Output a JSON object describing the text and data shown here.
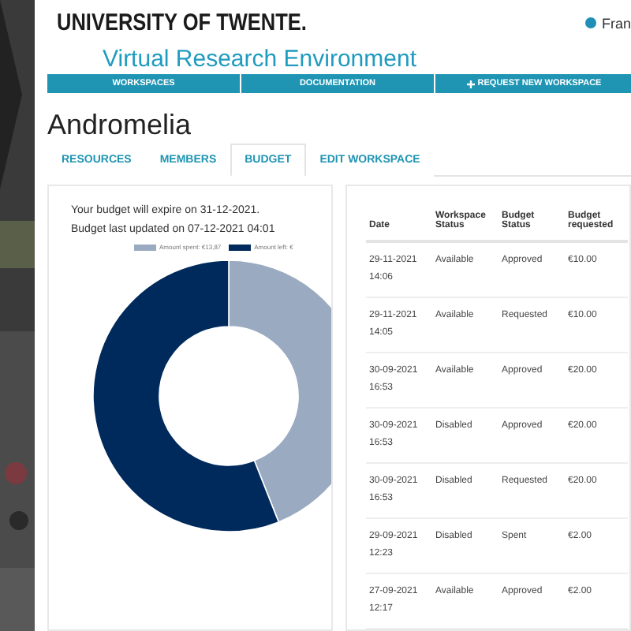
{
  "header": {
    "logo": "UNIVERSITY OF TWENTE.",
    "user": "Fran",
    "title": "Virtual Research Environment"
  },
  "nav": [
    {
      "label": "WORKSPACES",
      "kind": "link"
    },
    {
      "label": "DOCUMENTATION",
      "kind": "link"
    },
    {
      "label": "REQUEST NEW WORKSPACE",
      "kind": "add"
    }
  ],
  "workspace": "Andromelia",
  "tabs": [
    {
      "label": "RESOURCES",
      "selected": false
    },
    {
      "label": "MEMBERS",
      "selected": false
    },
    {
      "label": "BUDGET",
      "selected": true
    },
    {
      "label": "EDIT WORKSPACE",
      "selected": false
    }
  ],
  "budget": {
    "expire": "Your budget will expire on 31-12-2021.",
    "updated": "Budget last updated on 07-12-2021 04:01",
    "legend": [
      {
        "label": "Amount spent: €13,87",
        "color": "#9aabc1"
      },
      {
        "label": "Amount left: €",
        "color": "#002a5c"
      }
    ]
  },
  "table": {
    "columns": [
      "Date",
      "Workspace Status",
      "Budget Status",
      "Budget requested"
    ],
    "rows": [
      [
        "29-11-2021 14:06",
        "Available",
        "Approved",
        "€10.00"
      ],
      [
        "29-11-2021 14:05",
        "Available",
        "Requested",
        "€10.00"
      ],
      [
        "30-09-2021 16:53",
        "Available",
        "Approved",
        "€20.00"
      ],
      [
        "30-09-2021 16:53",
        "Disabled",
        "Approved",
        "€20.00"
      ],
      [
        "30-09-2021 16:53",
        "Disabled",
        "Requested",
        "€20.00"
      ],
      [
        "29-09-2021 12:23",
        "Disabled",
        "Spent",
        "€2.00"
      ],
      [
        "27-09-2021 12:17",
        "Available",
        "Approved",
        "€2.00"
      ]
    ]
  }
}
